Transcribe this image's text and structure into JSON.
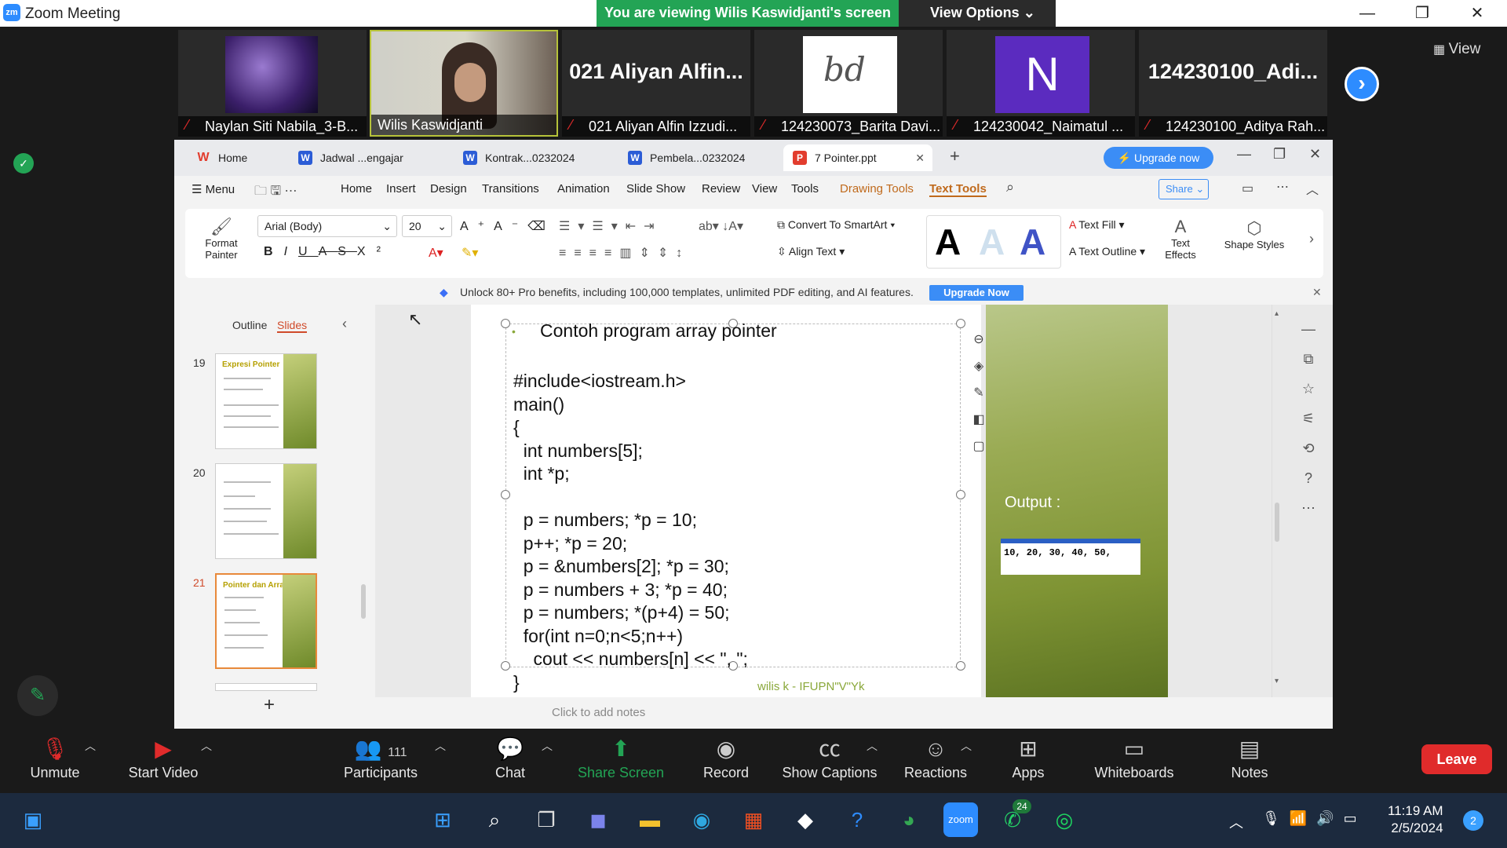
{
  "zoom": {
    "title": "Zoom Meeting",
    "logo_text": "zm",
    "banner": "You are viewing Wilis Kaswidjanti's screen",
    "view_options": "View Options",
    "view_button": "View",
    "participants_tiles": [
      {
        "name": "Naylan Siti Nabila_3-B...",
        "big": ""
      },
      {
        "name": "Wilis Kaswidjanti",
        "big": ""
      },
      {
        "name": "021 Aliyan Alfin Izzudi...",
        "big": "021 Aliyan Alfin..."
      },
      {
        "name": "124230073_Barita Davi...",
        "big": ""
      },
      {
        "name": "124230042_Naimatul ...",
        "big": "N"
      },
      {
        "name": "124230100_Aditya Rah...",
        "big": "124230100_Adi..."
      }
    ],
    "toolbar": {
      "unmute": "Unmute",
      "start_video": "Start Video",
      "participants": "Participants",
      "participants_count": "111",
      "chat": "Chat",
      "share_screen": "Share Screen",
      "record": "Record",
      "show_captions": "Show Captions",
      "reactions": "Reactions",
      "apps": "Apps",
      "whiteboards": "Whiteboards",
      "notes": "Notes",
      "leave": "Leave"
    }
  },
  "wps": {
    "tabs": [
      "Home",
      "Jadwal ...engajar",
      "Kontrak...0232024",
      "Pembela...0232024",
      "7 Pointer.ppt"
    ],
    "upgrade": "⚡ Upgrade now",
    "menu": [
      "Menu",
      "Home",
      "Insert",
      "Design",
      "Transitions",
      "Animation",
      "Slide Show",
      "Review",
      "View",
      "Tools",
      "Drawing Tools",
      "Text Tools"
    ],
    "share": "Share",
    "ribbon": {
      "format_painter": "Format Painter",
      "font": "Arial (Body)",
      "size": "20",
      "convert": "Convert To SmartArt",
      "align_text": "Align Text",
      "text_fill": "Text Fill",
      "text_outline": "Text Outline",
      "text_effects": "Text Effects",
      "shape_styles": "Shape Styles"
    },
    "promo": "Unlock 80+ Pro benefits, including 100,000 templates, unlimited PDF editing, and AI features.",
    "promo_btn": "Upgrade Now",
    "pane_tabs": [
      "Outline",
      "Slides"
    ],
    "thumbs": [
      {
        "num": "19",
        "title": "Expresi Pointer"
      },
      {
        "num": "20",
        "title": ""
      },
      {
        "num": "21",
        "title": "Pointer dan Array"
      }
    ],
    "notes_placeholder": "Click to add notes"
  },
  "slide": {
    "bullet": "Contoh program array pointer",
    "code": "#include<iostream.h>\nmain()\n{\n  int numbers[5];\n  int *p;\n\n  p = numbers; *p = 10;\n  p++; *p = 20;\n  p = &numbers[2]; *p = 30;\n  p = numbers + 3; *p = 40;\n  p = numbers; *(p+4) = 50;\n  for(int n=0;n<5;n++)\n    cout << numbers[n] << \", \";\n}",
    "output_label": "Output :",
    "output": "10, 20, 30, 40, 50,",
    "footer": "wilis k - IFUPN\"V\"Yk"
  },
  "taskbar": {
    "time": "11:19 AM",
    "date": "2/5/2024",
    "whatsapp_badge": "24",
    "notif_count": "2"
  }
}
